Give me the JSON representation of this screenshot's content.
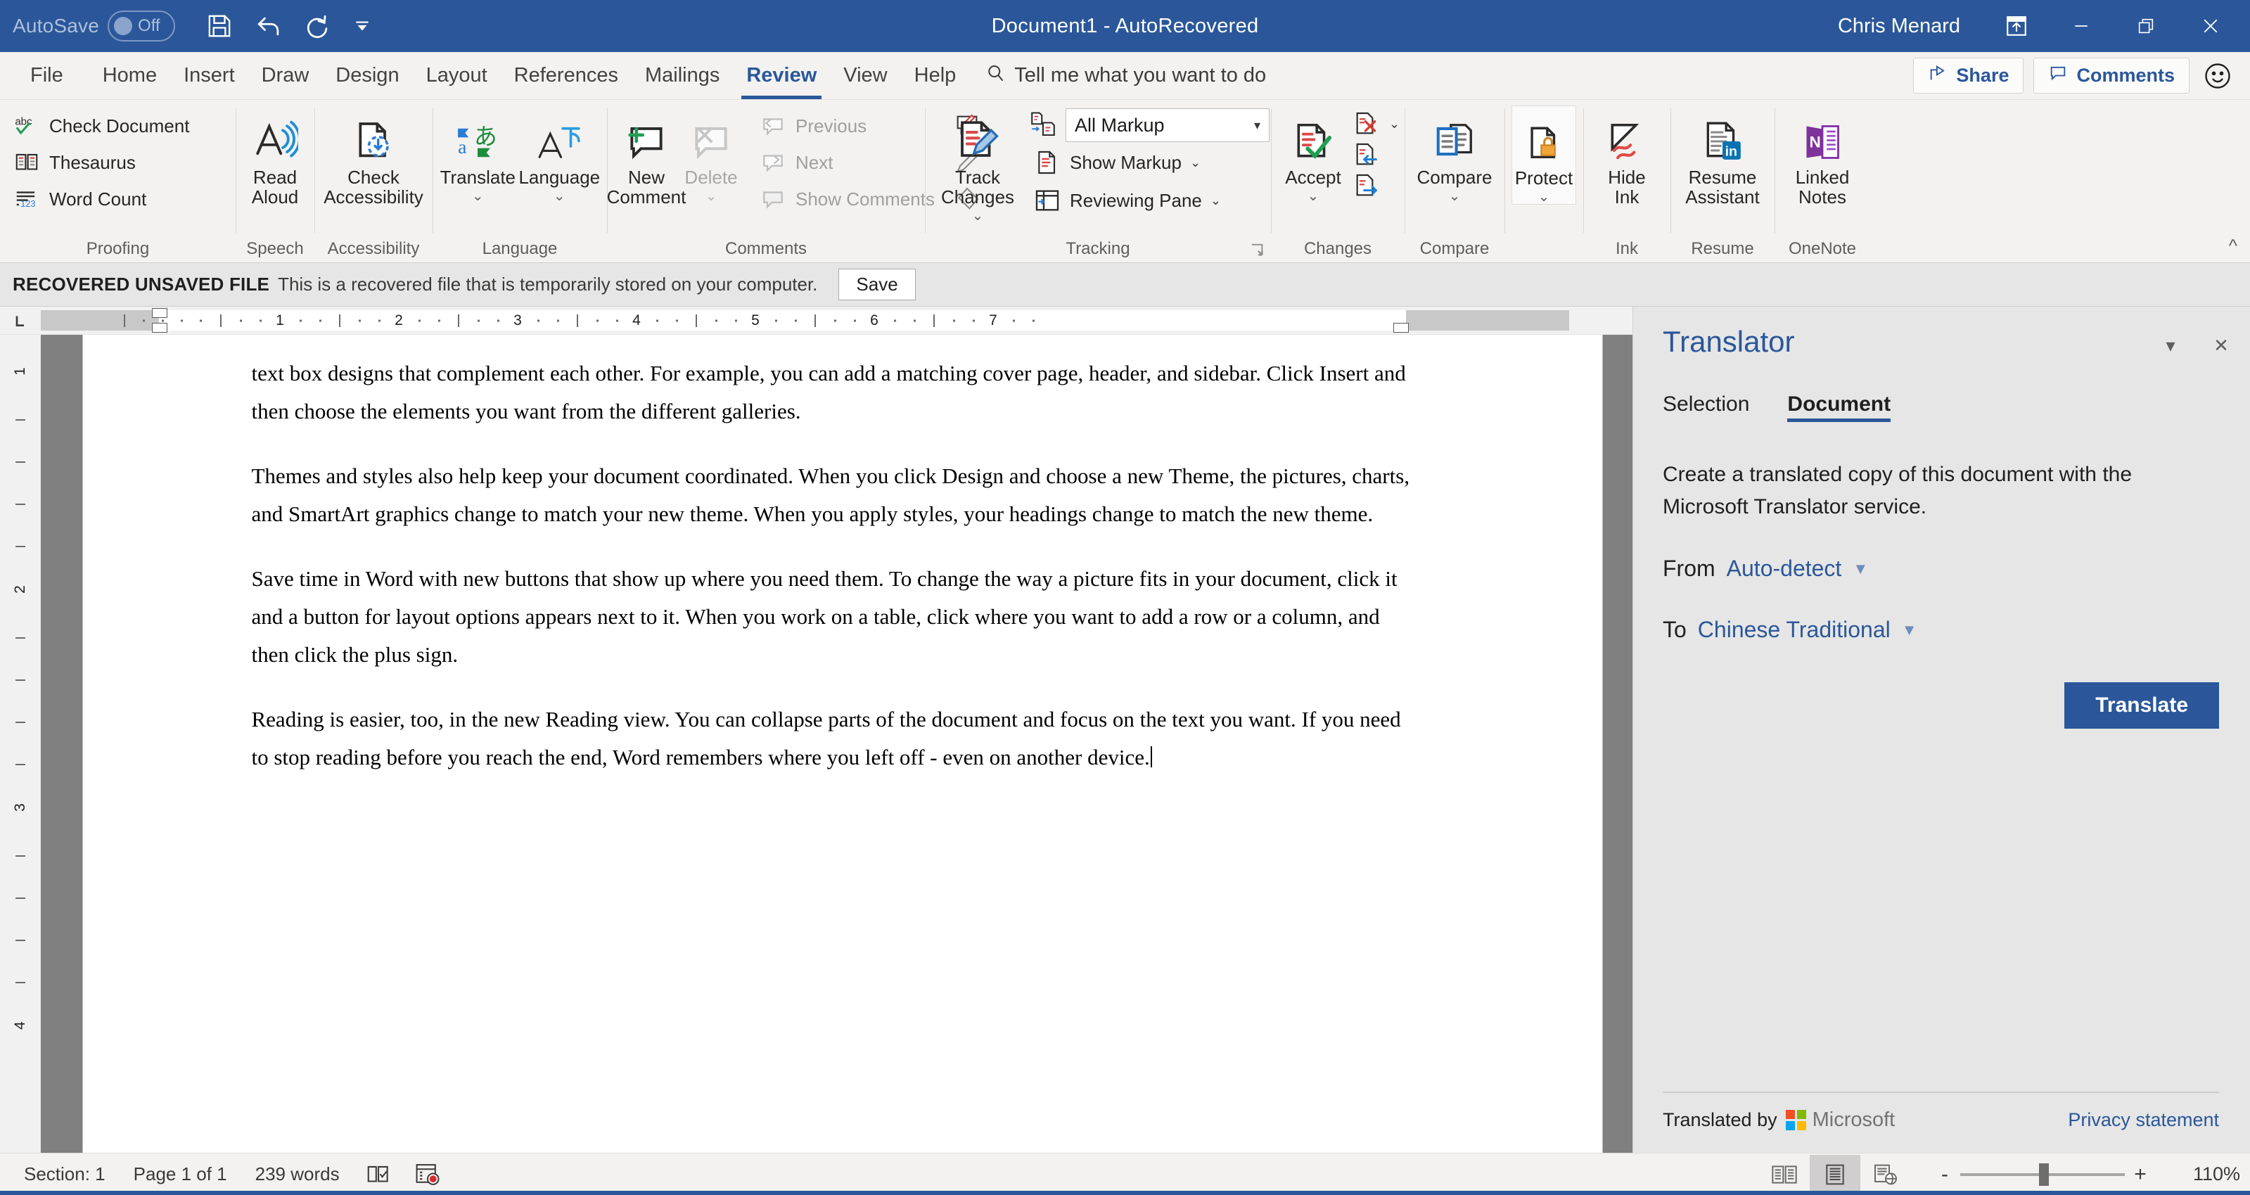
{
  "titlebar": {
    "autosave_label": "AutoSave",
    "autosave_state": "Off",
    "save_icon": "save-icon",
    "undo_icon": "undo-icon",
    "redo_icon": "redo-icon",
    "qat_more_icon": "customize-quick-access-toolbar-icon",
    "document_title": "Document1  -  AutoRecovered",
    "user_name": "Chris Menard",
    "ribbon_display_icon": "ribbon-display-options-icon",
    "minimize_icon": "minimize-icon",
    "restore_icon": "restore-icon",
    "close_icon": "close-icon"
  },
  "tabs": [
    {
      "label": "File",
      "active": false
    },
    {
      "label": "Home",
      "active": false
    },
    {
      "label": "Insert",
      "active": false
    },
    {
      "label": "Draw",
      "active": false
    },
    {
      "label": "Design",
      "active": false
    },
    {
      "label": "Layout",
      "active": false
    },
    {
      "label": "References",
      "active": false
    },
    {
      "label": "Mailings",
      "active": false
    },
    {
      "label": "Review",
      "active": true
    },
    {
      "label": "View",
      "active": false
    },
    {
      "label": "Help",
      "active": false
    }
  ],
  "tellme": {
    "placeholder": "Tell me what you want to do",
    "icon": "search-icon"
  },
  "tabstrip_right": {
    "share_label": "Share",
    "share_icon": "share-icon",
    "comments_label": "Comments",
    "comments_icon": "comment-bubble-icon",
    "feedback_icon": "smiley-face-icon"
  },
  "ribbon": {
    "collapse_icon": "collapse-ribbon-caret-icon",
    "groups": [
      {
        "name": "Proofing",
        "label": "Proofing",
        "small_buttons": [
          {
            "label": "Check Document",
            "icon": "abc-spellcheck-icon",
            "disabled": false
          },
          {
            "label": "Thesaurus",
            "icon": "open-book-icon",
            "disabled": false
          },
          {
            "label": "Word Count",
            "icon": "word-count-123-icon",
            "disabled": false
          }
        ]
      },
      {
        "name": "Speech",
        "label": "Speech",
        "big_buttons": [
          {
            "label": "Read\nAloud",
            "icon": "read-aloud-icon",
            "caret": false,
            "disabled": false
          }
        ]
      },
      {
        "name": "Accessibility",
        "label": "Accessibility",
        "big_buttons": [
          {
            "label": "Check\nAccessibility",
            "icon": "check-accessibility-icon",
            "caret": false,
            "disabled": false
          }
        ]
      },
      {
        "name": "Language",
        "label": "Language",
        "big_buttons": [
          {
            "label": "Translate",
            "icon": "translate-icon",
            "caret": true,
            "disabled": false
          },
          {
            "label": "Language",
            "icon": "language-icon",
            "caret": true,
            "disabled": false
          }
        ]
      },
      {
        "name": "Comments",
        "label": "Comments",
        "big_buttons": [
          {
            "label": "New\nComment",
            "icon": "new-comment-icon",
            "caret": false,
            "disabled": false
          },
          {
            "label": "Delete",
            "icon": "delete-comment-icon",
            "caret": true,
            "disabled": true
          }
        ],
        "small_buttons": [
          {
            "label": "Previous",
            "icon": "previous-comment-icon",
            "disabled": true
          },
          {
            "label": "Next",
            "icon": "next-comment-icon",
            "disabled": true
          },
          {
            "label": "Show Comments",
            "icon": "show-comments-icon",
            "disabled": true
          }
        ],
        "ink_icons": [
          {
            "icon": "ink-comment-icon"
          },
          {
            "icon": "ink-pen-icon"
          },
          {
            "icon": "ink-eraser-icon"
          }
        ]
      },
      {
        "name": "Tracking",
        "label": "Tracking",
        "has_dialog_launcher": true,
        "big_buttons": [
          {
            "label": "Track\nChanges",
            "icon": "track-changes-icon",
            "caret": true,
            "disabled": false
          }
        ],
        "markup_combo": {
          "value": "All Markup",
          "icon": "display-for-review-icon"
        },
        "small_buttons": [
          {
            "label": "Show Markup",
            "icon": "show-markup-icon",
            "caret": true,
            "disabled": false
          },
          {
            "label": "Reviewing Pane",
            "icon": "reviewing-pane-icon",
            "caret": true,
            "disabled": false
          }
        ]
      },
      {
        "name": "Changes",
        "label": "Changes",
        "big_buttons": [
          {
            "label": "Accept",
            "icon": "accept-change-icon",
            "caret": true,
            "disabled": false
          }
        ],
        "stack_icons": [
          {
            "icon": "reject-change-icon",
            "caret": true
          },
          {
            "icon": "previous-change-icon",
            "caret": false
          },
          {
            "icon": "next-change-icon",
            "caret": false
          }
        ]
      },
      {
        "name": "Compare",
        "label": "Compare",
        "big_buttons": [
          {
            "label": "Compare",
            "icon": "compare-documents-icon",
            "caret": true,
            "disabled": false
          }
        ]
      },
      {
        "name": "Protect",
        "label": "",
        "big_buttons": [
          {
            "label": "Protect",
            "icon": "protect-document-lock-icon",
            "caret": true,
            "disabled": false
          }
        ]
      },
      {
        "name": "Ink",
        "label": "Ink",
        "big_buttons": [
          {
            "label": "Hide\nInk",
            "icon": "hide-ink-icon",
            "caret": false,
            "disabled": false
          }
        ]
      },
      {
        "name": "Resume",
        "label": "Resume",
        "big_buttons": [
          {
            "label": "Resume\nAssistant",
            "icon": "resume-assistant-linkedin-icon",
            "caret": false,
            "disabled": false
          }
        ]
      },
      {
        "name": "OneNote",
        "label": "OneNote",
        "big_buttons": [
          {
            "label": "Linked\nNotes",
            "icon": "onenote-linked-notes-icon",
            "caret": false,
            "disabled": false
          }
        ]
      }
    ]
  },
  "recovered_bar": {
    "badge": "RECOVERED UNSAVED FILE",
    "message": "This is a recovered file that is temporarily stored on your computer.",
    "save_label": "Save"
  },
  "ruler": {
    "tab_selector_icon": "left-tab-stop-icon",
    "numbers": [
      "1",
      "2",
      "3",
      "4",
      "5",
      "6",
      "7"
    ],
    "vertical_numbers": [
      "1",
      "2",
      "3",
      "4"
    ]
  },
  "document": {
    "paragraphs": [
      "text box designs that complement each other. For example, you can add a matching cover page, header, and sidebar. Click Insert and then choose the elements you want from the different galleries.",
      "Themes and styles also help keep your document coordinated. When you click Design and choose a new Theme, the pictures, charts, and SmartArt graphics change to match your new theme. When you apply styles, your headings change to match the new theme.",
      "Save time in Word with new buttons that show up where you need them. To change the way a picture fits in your document, click it and a button for layout options appears next to it. When you work on a table, click where you want to add a row or a column, and then click the plus sign.",
      "Reading is easier, too, in the new Reading view. You can collapse parts of the document and focus on the text you want. If you need to stop reading before you reach the end, Word remembers where you left off - even on another device."
    ]
  },
  "translator_pane": {
    "title": "Translator",
    "minimize_icon": "pane-options-caret-icon",
    "close_icon": "pane-close-icon",
    "tabs": [
      {
        "label": "Selection",
        "active": false
      },
      {
        "label": "Document",
        "active": true
      }
    ],
    "description": "Create a translated copy of this document with the Microsoft Translator service.",
    "from_label": "From",
    "from_value": "Auto-detect",
    "to_label": "To",
    "to_value": "Chinese Traditional",
    "translate_label": "Translate",
    "translated_by_label": "Translated by",
    "microsoft_label": "Microsoft",
    "microsoft_logo_icon": "microsoft-logo-icon",
    "privacy_label": "Privacy statement"
  },
  "statusbar": {
    "section": "Section: 1",
    "page": "Page 1 of 1",
    "words": "239 words",
    "proofing_icon": "proofing-status-icon",
    "macro_icon": "record-macro-icon",
    "views": [
      {
        "icon": "read-mode-icon",
        "active": false
      },
      {
        "icon": "print-layout-icon",
        "active": true
      },
      {
        "icon": "web-layout-icon",
        "active": false
      }
    ],
    "zoom_out": "-",
    "zoom_in": "+",
    "zoom_level": "110%"
  },
  "colors": {
    "word_blue": "#2b579a",
    "ribbon_bg": "#f3f2f1",
    "pane_bg": "#e6e6e6",
    "canvas_gray": "#808080"
  }
}
